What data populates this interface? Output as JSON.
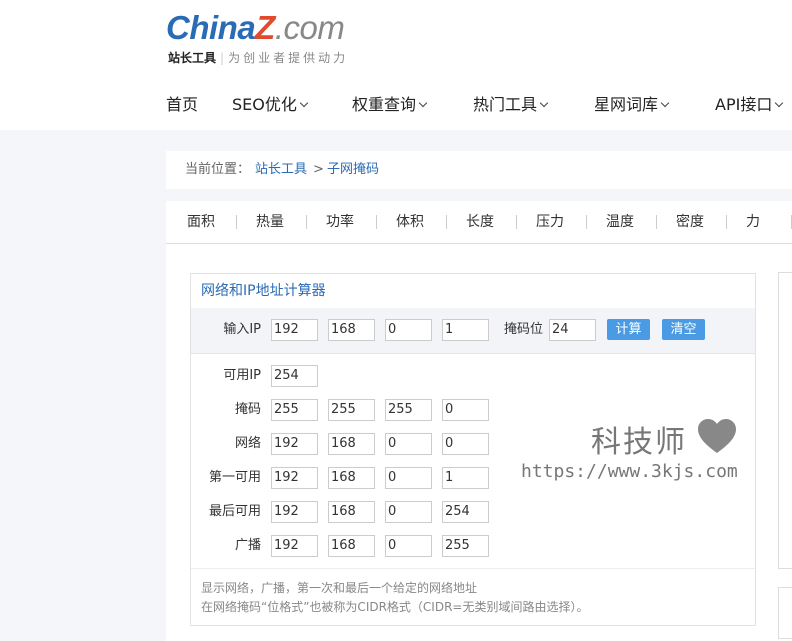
{
  "logo": {
    "part1": "China",
    "part2": "Z",
    "part3": ".com",
    "sub_bold": "站长工具",
    "sub_sep": "|",
    "slogan": "为创业者提供动力"
  },
  "nav": [
    {
      "label": "首页"
    },
    {
      "label": "SEO优化"
    },
    {
      "label": "权重查询"
    },
    {
      "label": "热门工具"
    },
    {
      "label": "星网词库"
    },
    {
      "label": "API接口"
    }
  ],
  "breadcrumb": {
    "label": "当前位置：",
    "link1": "站长工具",
    "sep": ">",
    "link2": "子网掩码"
  },
  "tabs": [
    "面积",
    "热量",
    "功率",
    "体积",
    "长度",
    "压力",
    "温度",
    "密度",
    "力"
  ],
  "calculator": {
    "title": "网络和IP地址计算器",
    "input_label": "输入IP",
    "ip": [
      "192",
      "168",
      "0",
      "1"
    ],
    "mask_bits_label": "掩码位",
    "mask_bits": "24",
    "calc_button": "计算",
    "clear_button": "清空",
    "usable_ip_label": "可用IP",
    "usable_ip": "254",
    "rows": [
      {
        "label": "掩码",
        "values": [
          "255",
          "255",
          "255",
          "0"
        ]
      },
      {
        "label": "网络",
        "values": [
          "192",
          "168",
          "0",
          "0"
        ]
      },
      {
        "label": "第一可用",
        "values": [
          "192",
          "168",
          "0",
          "1"
        ]
      },
      {
        "label": "最后可用",
        "values": [
          "192",
          "168",
          "0",
          "254"
        ]
      },
      {
        "label": "广播",
        "values": [
          "192",
          "168",
          "0",
          "255"
        ]
      }
    ],
    "desc1": "显示网络，广播，第一次和最后一个给定的网络地址",
    "desc2": "在网络掩码“位格式”也被称为CIDR格式（CIDR=无类别域间路由选择）。"
  },
  "watermark": {
    "title": "科技师",
    "url": "https://www.3kjs.com"
  },
  "colors": {
    "accent": "#2a6bb5",
    "button": "#4a9be4",
    "logo_red": "#e04a2e"
  }
}
